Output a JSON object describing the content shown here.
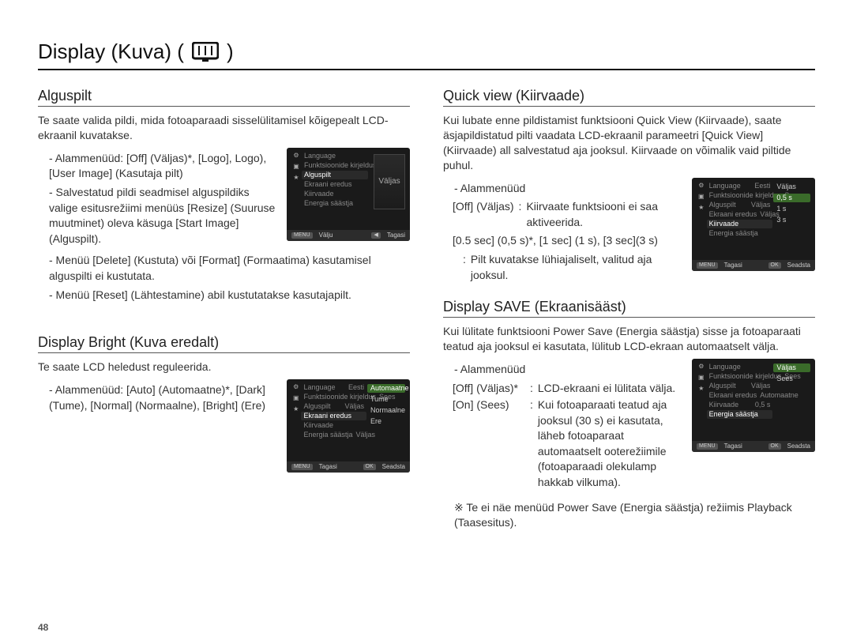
{
  "page_title": "Display (Kuva) (",
  "page_title_close": ")",
  "page_number": "48",
  "left": {
    "sec1": {
      "h": "Alguspilt",
      "p1": "Te saate valida pildi, mida fotoaparaadi sisselülitamisel kõigepealt LCD-ekraanil kuvatakse.",
      "b1": "- Alammenüüd: [Off] (Väljas)*, [Logo], Logo), [User Image] (Kasutaja pilt)",
      "b2": "- Salvestatud pildi seadmisel alguspildiks valige esitusrežiimi menüüs [Resize] (Suuruse muutminet) oleva käsuga [Start Image] (Alguspilt).",
      "b3": "- Menüü [Delete] (Kustuta) või [Format] (Formaatima) kasutamisel alguspilti ei kustutata.",
      "b4": "- Menüü [Reset] (Lähtestamine) abil kustutatakse kasutajapilt.",
      "lcd": {
        "menu": [
          "Language",
          "Funktsioonide kirjeldus",
          "Alguspilt",
          "Ekraani eredus",
          "Kiirvaade",
          "Energia säästja"
        ],
        "selected_index": 2,
        "preview_label": "Väljas",
        "foot_left_k": "MENU",
        "foot_left_t": "Välju",
        "foot_right_k": "◀",
        "foot_right_t": "Tagasi"
      }
    },
    "sec2": {
      "h": "Display Bright (Kuva eredalt)",
      "p1": "Te saate LCD heledust reguleerida.",
      "b1": "- Alammenüüd: [Auto] (Automaatne)*, [Dark] (Tume), [Normal] (Normaalne), [Bright] (Ere)",
      "lcd": {
        "menu": [
          "Language",
          "Funktsioonide kirjeldus",
          "Alguspilt",
          "Ekraani eredus",
          "Kiirvaade",
          "Energia säästja"
        ],
        "selected_index": 3,
        "vals": [
          "Eesti",
          "Sees",
          "Väljas",
          "",
          "",
          "Väljas"
        ],
        "opts": [
          "Automaatne",
          "Tume",
          "Normaalne",
          "Ere"
        ],
        "opt_selected": 0,
        "foot_left_k": "MENU",
        "foot_left_t": "Tagasi",
        "foot_right_k": "OK",
        "foot_right_t": "Seadsta"
      }
    }
  },
  "right": {
    "sec1": {
      "h": "Quick view (Kiirvaade)",
      "p1": "Kui lubate enne pildistamist funktsiooni Quick View (Kiirvaade), saate äsjapildistatud pilti vaadata LCD-ekraanil parameetri [Quick View] (Kiirvaade) all salvestatud aja jooksul. Kiirvaade on võimalik vaid piltide puhul.",
      "sub_h": "- Alammenüüd",
      "d1_k": "[Off] (Väljas)",
      "d1_c": ":",
      "d1_v": "Kiirvaate funktsiooni ei saa aktiveerida.",
      "d2_k": "[0.5 sec] (0,5 s)*, [1 sec] (1 s), [3 sec](3 s)",
      "d2_c": ":",
      "d2_v": "Pilt kuvatakse lühiajaliselt, valitud aja jooksul.",
      "lcd": {
        "menu": [
          "Language",
          "Funktsioonide kirjeldus",
          "Alguspilt",
          "Ekraani eredus",
          "Kiirvaade",
          "Energia säästja"
        ],
        "selected_index": 4,
        "vals": [
          "Eesti",
          "Sees",
          "Väljas",
          "Väljas",
          "",
          ""
        ],
        "opts": [
          "Väljas",
          "0,5 s",
          "1 s",
          "3 s"
        ],
        "opt_selected": 1,
        "foot_left_k": "MENU",
        "foot_left_t": "Tagasi",
        "foot_right_k": "OK",
        "foot_right_t": "Seadsta"
      }
    },
    "sec2": {
      "h": "Display SAVE (Ekraanisääst)",
      "p1": "Kui lülitate funktsiooni Power Save (Energia säästja) sisse ja fotoaparaati teatud aja jooksul ei kasutata, lülitub LCD-ekraan automaatselt välja.",
      "sub_h": "- Alammenüüd",
      "d1_k": "[Off] (Väljas)*",
      "d1_c": ":",
      "d1_v": "LCD-ekraani ei lülitata välja.",
      "d2_k": "[On] (Sees)",
      "d2_c": ":",
      "d2_v": "Kui fotoaparaati teatud aja jooksul (30 s) ei kasutata, läheb fotoaparaat automaatselt ooterežiimile (fotoaparaadi olekulamp hakkab vilkuma).",
      "note": "※ Te ei näe menüüd Power Save (Energia säästja) režiimis Playback (Taasesitus).",
      "lcd": {
        "menu": [
          "Language",
          "Funktsioonide kirjeldus",
          "Alguspilt",
          "Ekraani eredus",
          "Kiirvaade",
          "Energia säästja"
        ],
        "selected_index": 5,
        "vals": [
          "",
          "Sees",
          "Väljas",
          "Automaatne",
          "0,5 s",
          ""
        ],
        "opts": [
          "Väljas",
          "Sees"
        ],
        "opt_selected": 0,
        "foot_left_k": "MENU",
        "foot_left_t": "Tagasi",
        "foot_right_k": "OK",
        "foot_right_t": "Seadsta"
      }
    }
  }
}
